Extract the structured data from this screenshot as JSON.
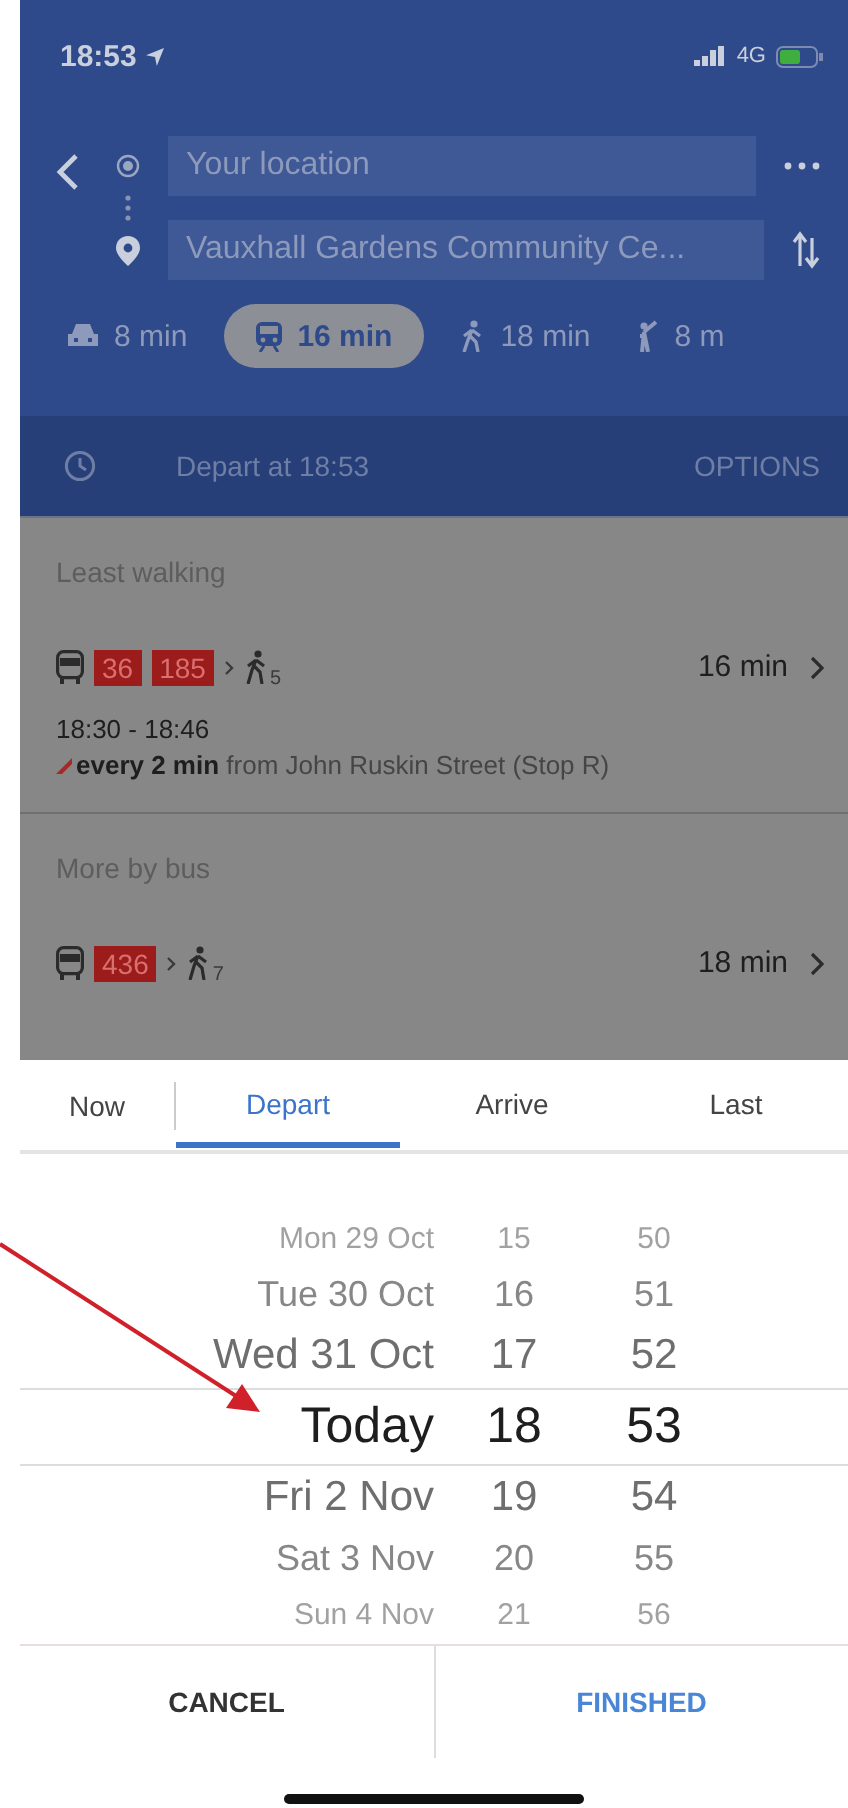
{
  "status_bar": {
    "time": "18:53",
    "network": "4G"
  },
  "route": {
    "origin": "Your location",
    "destination": "Vauxhall Gardens Community Ce..."
  },
  "modes": [
    {
      "kind": "car",
      "label": "8 min",
      "selected": false
    },
    {
      "kind": "transit",
      "label": "16 min",
      "selected": true
    },
    {
      "kind": "walk",
      "label": "18 min",
      "selected": false
    },
    {
      "kind": "ride",
      "label": "8 m",
      "selected": false
    }
  ],
  "depart_bar": {
    "label": "Depart at 18:53",
    "action": "OPTIONS"
  },
  "sections": [
    {
      "heading": "Least walking",
      "routes": [
        {
          "lines": [
            "36",
            "185"
          ],
          "walk": "5",
          "duration": "16 min",
          "times": "18:30 - 18:46",
          "frequency": "**every 2 min** from John Ruskin Street (Stop R)"
        }
      ]
    },
    {
      "heading": "More by bus",
      "routes": [
        {
          "lines": [
            "436"
          ],
          "walk": "7",
          "duration": "18 min"
        }
      ]
    }
  ],
  "picker_tabs": [
    {
      "label": "Now",
      "selected": false
    },
    {
      "label": "Depart",
      "selected": true
    },
    {
      "label": "Arrive",
      "selected": false
    },
    {
      "label": "Last",
      "selected": false
    }
  ],
  "picker_rows": [
    {
      "date": "Mon 29 Oct",
      "hour": "15",
      "minute": "50",
      "selected": false
    },
    {
      "date": "Tue 30 Oct",
      "hour": "16",
      "minute": "51",
      "selected": false
    },
    {
      "date": "Wed 31 Oct",
      "hour": "17",
      "minute": "52",
      "selected": false
    },
    {
      "date": "Today",
      "hour": "18",
      "minute": "53",
      "selected": true
    },
    {
      "date": "Fri 2 Nov",
      "hour": "19",
      "minute": "54",
      "selected": false
    },
    {
      "date": "Sat 3 Nov",
      "hour": "20",
      "minute": "55",
      "selected": false
    },
    {
      "date": "Sun 4 Nov",
      "hour": "21",
      "minute": "56",
      "selected": false
    }
  ],
  "buttons": [
    {
      "kind": "cancel",
      "label": "CANCEL"
    },
    {
      "kind": "confirm",
      "label": "FINISHED"
    }
  ]
}
